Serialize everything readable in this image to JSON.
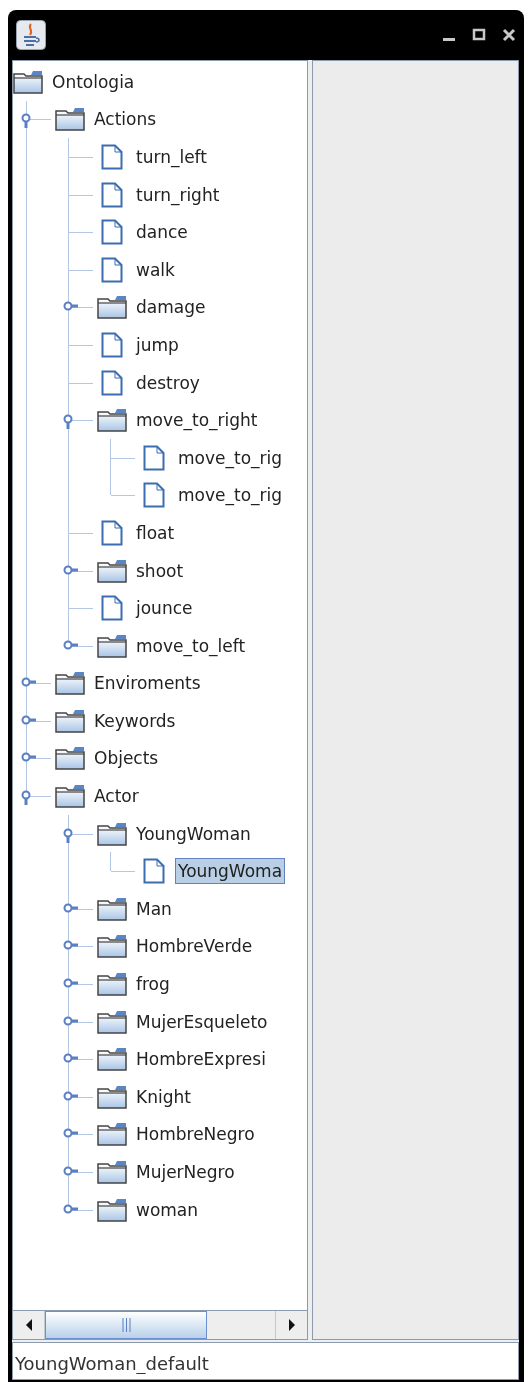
{
  "window": {
    "controls": [
      {
        "kind": "minimize"
      },
      {
        "kind": "maximize"
      },
      {
        "kind": "close"
      }
    ]
  },
  "tree": [
    {
      "label": "Ontologia",
      "kind": "folder",
      "selected": false,
      "children": [
        {
          "label": "Actions",
          "kind": "folder",
          "expanded": true,
          "selected": false,
          "children": [
            {
              "label": "turn_left",
              "kind": "leaf",
              "selected": false
            },
            {
              "label": "turn_right",
              "kind": "leaf",
              "selected": false
            },
            {
              "label": "dance",
              "kind": "leaf",
              "selected": false
            },
            {
              "label": "walk",
              "kind": "leaf",
              "selected": false
            },
            {
              "label": "damage",
              "kind": "folder",
              "expanded": false,
              "selected": false
            },
            {
              "label": "jump",
              "kind": "leaf",
              "selected": false
            },
            {
              "label": "destroy",
              "kind": "leaf",
              "selected": false
            },
            {
              "label": "move_to_right",
              "kind": "folder",
              "expanded": true,
              "selected": false,
              "children": [
                {
                  "label": "move_to_rig",
                  "kind": "leaf",
                  "selected": false
                },
                {
                  "label": "move_to_rig",
                  "kind": "leaf",
                  "selected": false
                }
              ]
            },
            {
              "label": "float",
              "kind": "leaf",
              "selected": false
            },
            {
              "label": "shoot",
              "kind": "folder",
              "expanded": false,
              "selected": false
            },
            {
              "label": "jounce",
              "kind": "leaf",
              "selected": false
            },
            {
              "label": "move_to_left",
              "kind": "folder",
              "expanded": false,
              "selected": false
            }
          ]
        },
        {
          "label": "Enviroments",
          "kind": "folder",
          "expanded": false,
          "selected": false
        },
        {
          "label": "Keywords",
          "kind": "folder",
          "expanded": false,
          "selected": false
        },
        {
          "label": "Objects",
          "kind": "folder",
          "expanded": false,
          "selected": false
        },
        {
          "label": "Actor",
          "kind": "folder",
          "expanded": true,
          "selected": false,
          "children": [
            {
              "label": "YoungWoman",
              "kind": "folder",
              "expanded": true,
              "selected": false,
              "children": [
                {
                  "label": "YoungWoma",
                  "kind": "leaf",
                  "selected": true
                }
              ]
            },
            {
              "label": "Man",
              "kind": "folder",
              "expanded": false,
              "selected": false
            },
            {
              "label": "HombreVerde",
              "kind": "folder",
              "expanded": false,
              "selected": false
            },
            {
              "label": "frog",
              "kind": "folder",
              "expanded": false,
              "selected": false
            },
            {
              "label": "MujerEsqueleto",
              "kind": "folder",
              "expanded": false,
              "selected": false
            },
            {
              "label": "HombreExpresi",
              "kind": "folder",
              "expanded": false,
              "selected": false
            },
            {
              "label": "Knight",
              "kind": "folder",
              "expanded": false,
              "selected": false
            },
            {
              "label": "HombreNegro",
              "kind": "folder",
              "expanded": false,
              "selected": false
            },
            {
              "label": "MujerNegro",
              "kind": "folder",
              "expanded": false,
              "selected": false
            },
            {
              "label": "woman",
              "kind": "folder",
              "expanded": false,
              "selected": false
            }
          ]
        }
      ]
    }
  ],
  "status_field": {
    "value": "YoungWoman_default"
  }
}
